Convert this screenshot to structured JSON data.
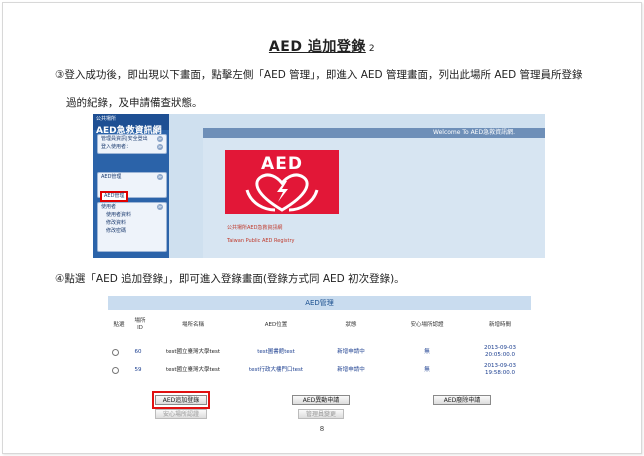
{
  "document": {
    "title": "AED 追加登錄",
    "title_marker": "2",
    "step3_line1": "③登入成功後，即出現以下畫面，點擊左側「AED 管理」，即進入 AED 管理畫面，列出此場所 AED 管理員所登錄",
    "step3_line2": "過的紀錄，及申請備查狀態。",
    "step4_line": "④點選「AED 追加登錄」，即可進入登錄畫面(登錄方式同 AED 初次登錄)。",
    "page_number": "8"
  },
  "screenshot1": {
    "sidebar": {
      "header_small": "公共場所",
      "title": "AED急救資訊網",
      "user_box": [
        {
          "label": "管理員資訊|安全登出",
          "icon": "≫"
        },
        {
          "label": "登入使用者：",
          "icon": "≫"
        }
      ],
      "aed_box": {
        "heading": "AED管理",
        "highlighted_item": "AED管理",
        "icon": "≫"
      },
      "user_mgmt_box": {
        "heading": "使用者",
        "items": [
          "使用者資料",
          "修改資料",
          "修改密碼"
        ],
        "icon": "≫"
      }
    },
    "main": {
      "welcome": "Welcome To AED急救資訊網.",
      "logo_text": "AED",
      "subtitle_cn": "公共場所AED急救資訊網",
      "subtitle_en": "Taiwan Public AED Registry"
    }
  },
  "screenshot2": {
    "header": "AED管理",
    "columns": [
      "點選",
      "場所\nID",
      "場所名稱",
      "AED位置",
      "狀態",
      "安心場所認證",
      "新增時間"
    ],
    "rows": [
      {
        "id": "60",
        "place": "test國立臺灣大學test",
        "location": "test圖書館test",
        "status": "新增申請中",
        "cert": "無",
        "date": "2013-09-03",
        "time": "20:05:00.0"
      },
      {
        "id": "59",
        "place": "test國立臺灣大學test",
        "location": "test行政大樓門口test",
        "status": "新增申請中",
        "cert": "無",
        "date": "2013-09-03",
        "time": "19:58:00.0"
      }
    ],
    "buttons": {
      "add": "AED追加登錄",
      "change": "AED異動申請",
      "remove": "AED廢除申請",
      "safe_cert": "安心場所認證",
      "manager_change": "管理員變更"
    }
  }
}
